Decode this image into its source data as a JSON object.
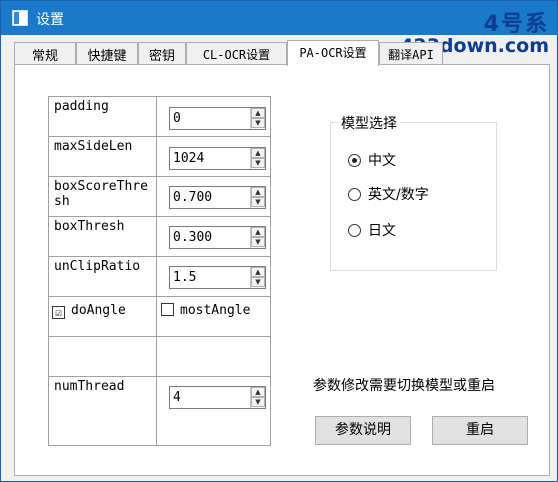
{
  "window": {
    "title": "设置"
  },
  "watermark": {
    "line1": "4号系",
    "line2": "423down.com"
  },
  "tabs": [
    {
      "label": "常规",
      "active": false
    },
    {
      "label": "快捷键",
      "active": false
    },
    {
      "label": "密钥",
      "active": false
    },
    {
      "label": "CL-OCR设置",
      "active": false
    },
    {
      "label": "PA-OCR设置",
      "active": true
    },
    {
      "label": "翻译API",
      "active": false
    }
  ],
  "params": [
    {
      "label": "padding",
      "value": "0"
    },
    {
      "label": "maxSideLen",
      "value": "1024"
    },
    {
      "label": "boxScoreThresh",
      "value": "0.700"
    },
    {
      "label": "boxThresh",
      "value": "0.300"
    },
    {
      "label": "unClipRatio",
      "value": "1.5"
    },
    {
      "label": "numThread",
      "value": "4"
    }
  ],
  "checks": [
    {
      "label": "doAngle",
      "checked": true,
      "mark": "☑"
    },
    {
      "label": "mostAngle",
      "checked": false,
      "mark": ""
    }
  ],
  "model": {
    "title": "模型选择",
    "options": [
      {
        "label": "中文",
        "selected": true
      },
      {
        "label": "英文/数字",
        "selected": false
      },
      {
        "label": "日文",
        "selected": false
      }
    ]
  },
  "notice": "参数修改需要切换模型或重启",
  "buttons": {
    "help": "参数说明",
    "restart": "重启"
  }
}
